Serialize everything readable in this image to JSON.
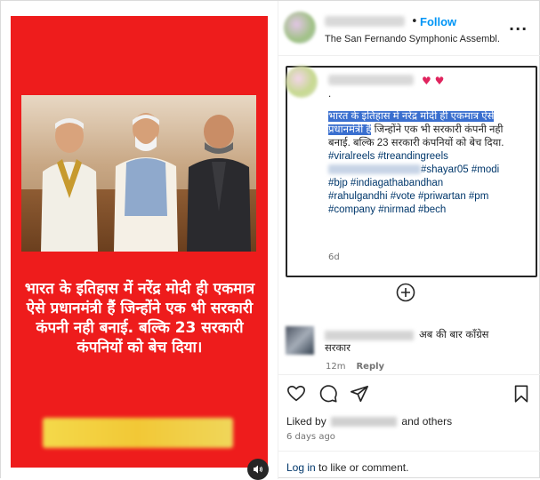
{
  "post": {
    "follow_label": "Follow",
    "dot": "•",
    "subtitle": "The San Fernando Symphonic Assembl...",
    "more_label": "···",
    "poster_text": "भारत के इतिहास में नरेंद्र मोदी ही एकमात्र ऐसे प्रधानमंत्री हैं जिन्होंने एक भी सरकारी कंपनी नही बनाई. बल्कि 23 सरकारी कंपनियों को बेच दिया।"
  },
  "caption": {
    "hearts": "♥ ♥",
    "dot": ".",
    "highlighted": "भारत के इतिहास में नरेंद्र मोदी ही एकमात्र ऐसे प्रधानमंत्री हैं",
    "rest": " जिन्होंने एक भी सरकारी कंपनी नही बनाई. बल्कि 23 सरकारी कंपनियों को बेच दिया.",
    "tags_line1": "#viralreels #treandingreels",
    "tags_line2_end": "#shayar05 #modi",
    "tags_line3": "#bjp #indiagathabandhan",
    "tags_line4": "#rahulgandhi #vote #priwartan #pm",
    "tags_line5": "#company #nirmad #bech",
    "time": "6d"
  },
  "comment": {
    "text_line1": "अब की बार कॉंग्रेस",
    "text_line2": "सरकार",
    "time": "12m",
    "reply_label": "Reply"
  },
  "likes": {
    "prefix": "Liked by",
    "suffix": "and others",
    "ago": "6 days ago"
  },
  "login": {
    "link": "Log in",
    "rest": " to like or comment."
  },
  "colors": {
    "poster_red": "#ee1c1c",
    "link_blue": "#0095f6",
    "highlight": "#3a6fcf"
  }
}
